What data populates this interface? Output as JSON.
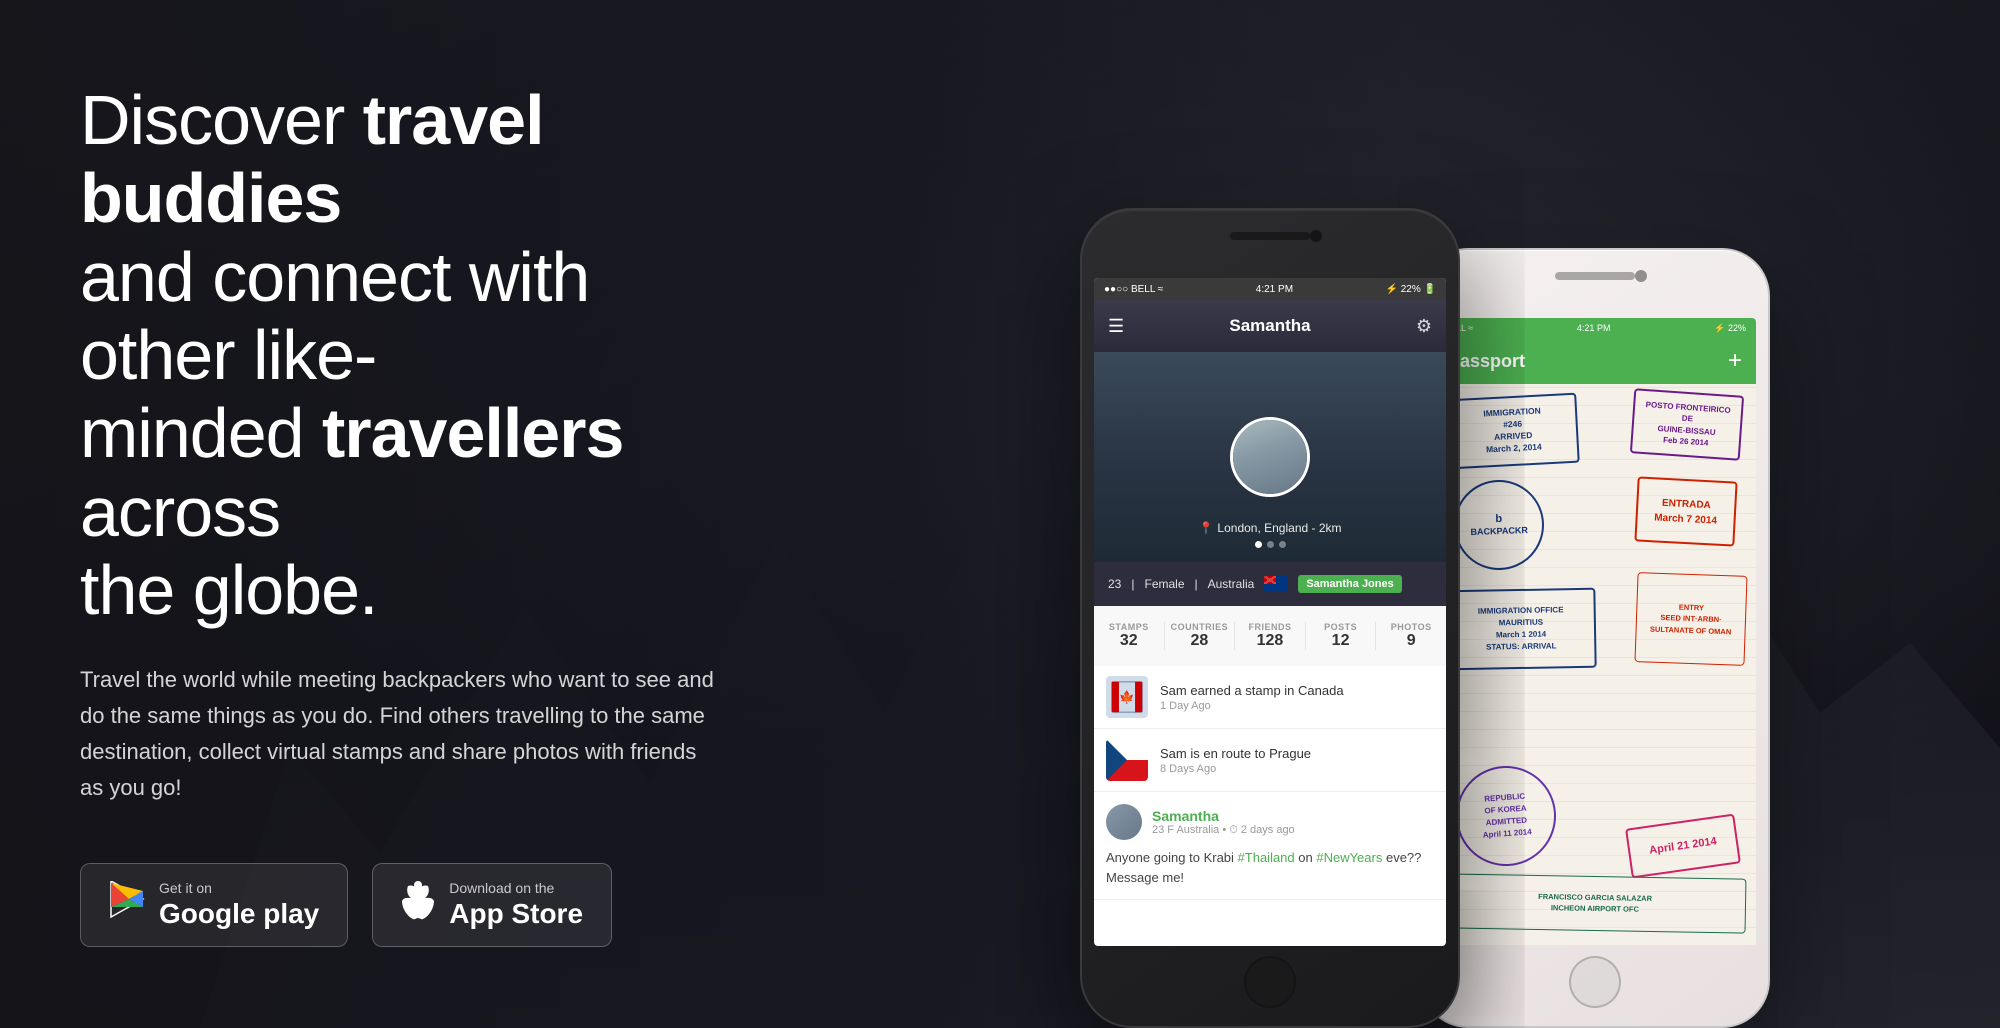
{
  "hero": {
    "headline_part1": "Discover ",
    "headline_bold1": "travel buddies",
    "headline_part2": " and connect with other like-minded ",
    "headline_bold2": "travellers",
    "headline_part3": " across the globe.",
    "subtext": "Travel the world while meeting backpackers who want to see and do the same things as you do. Find others travelling to the same destination, collect virtual stamps and share photos with friends as you go!"
  },
  "store_buttons": {
    "google_play": {
      "top": "Get it on",
      "main": "Google play"
    },
    "app_store": {
      "top": "Download on the",
      "main": "App Store"
    }
  },
  "phone1": {
    "status_bar": {
      "carrier": "BELL",
      "time": "4:21 PM",
      "battery": "22%"
    },
    "header": {
      "title": "Samantha"
    },
    "profile": {
      "location": "London, England - 2km",
      "age": "23",
      "gender": "Female",
      "country": "Australia",
      "name": "Samantha Jones"
    },
    "stats": {
      "stamps_label": "STAMPS",
      "stamps_value": "32",
      "countries_label": "COUNTRIES",
      "countries_value": "28",
      "friends_label": "FRIENDS",
      "friends_value": "128",
      "posts_label": "POSTS",
      "posts_value": "12",
      "photos_label": "PHOTOS",
      "photos_value": "9"
    },
    "feed": [
      {
        "title": "Sam earned a stamp in Canada",
        "time": "1 Day Ago"
      },
      {
        "title": "Sam is en route to Prague",
        "time": "8 Days Ago"
      }
    ],
    "post": {
      "name": "Samantha",
      "details": "23 F Australia  •  ⏱ 2 days ago",
      "text": "Anyone going to Krabi #Thailand on #NewYears eve?? Message me!"
    }
  },
  "phone2": {
    "status_bar": {
      "carrier": "BELL",
      "time": "4:21 PM",
      "battery": "22%"
    },
    "header": {
      "title": "Passport"
    },
    "stamps": [
      {
        "text": "IMMIGRATION\n#246\nARRIVED\nMarch 2, 2014",
        "style": "blue",
        "rotate": -3
      },
      {
        "text": "POSTO FRONTEIRICO\nDE\nGUINE-BISSAU\nFeb 26 2014",
        "style": "red",
        "rotate": 4
      },
      {
        "text": "BACKPACKR",
        "style": "blue-round",
        "rotate": -2
      },
      {
        "text": "ENTRADA\nMarch 7 2014",
        "style": "red-bold",
        "rotate": 3
      },
      {
        "text": "IMMIGRATION OFFICE\nMAURITIUS\nMarch 1 2014\nARRIVAL",
        "style": "blue",
        "rotate": -1
      },
      {
        "text": "ENTRY\nSEED INT·ARBN\nSULTANATE OF OMAN",
        "style": "red",
        "rotate": 2
      },
      {
        "text": "REPUBLIC OF KOREA\nADMITTED\nApril 11 2014",
        "style": "purple-round",
        "rotate": -4
      },
      {
        "text": "April 21 2014",
        "style": "pink",
        "rotate": -8
      }
    ]
  }
}
